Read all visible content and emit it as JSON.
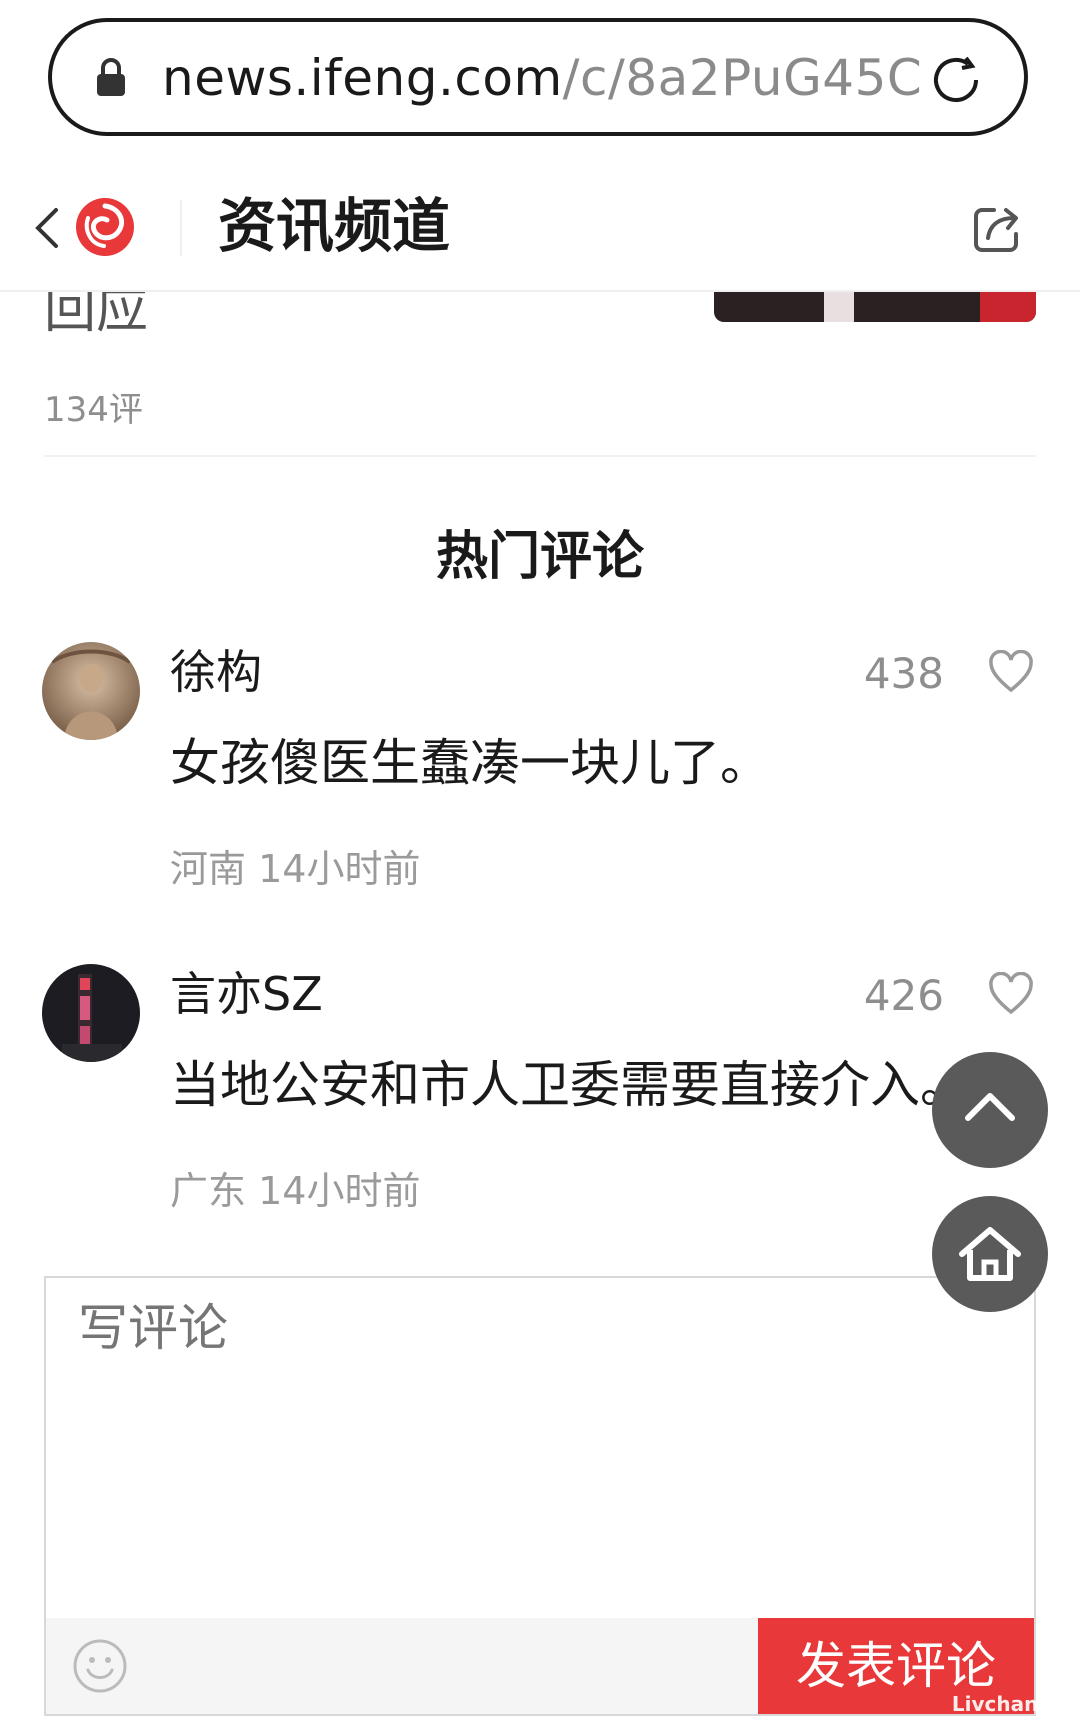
{
  "browser": {
    "url_host": "news.ifeng.com",
    "url_path": "/c/8a2PuG45C",
    "icons": [
      "lock-icon",
      "reload-icon"
    ]
  },
  "header": {
    "channel_title": "资讯频道",
    "icons": [
      "back-icon",
      "ifeng-logo",
      "share-icon"
    ]
  },
  "previous_article": {
    "title_fragment": "回应",
    "comment_count": "134评"
  },
  "comments_section": {
    "title": "热门评论",
    "items": [
      {
        "username": "徐构",
        "likes": "438",
        "text": "女孩傻医生蠢凑一块儿了。",
        "location": "河南",
        "time": "14小时前"
      },
      {
        "username": "言亦SZ",
        "likes": "426",
        "text": "当地公安和市人卫委需要直接介入。",
        "location": "广东",
        "time": "14小时前"
      }
    ]
  },
  "floating": {
    "icons": [
      "scroll-top-icon",
      "home-icon"
    ]
  },
  "compose": {
    "placeholder": "写评论",
    "submit_label": "发表评论",
    "icons": [
      "emoji-icon"
    ]
  },
  "watermark": "Livchan.cn",
  "colors": {
    "accent_red": "#e8383a",
    "muted_text": "#8e8e8e",
    "fab_gray": "#5a5a5a"
  }
}
